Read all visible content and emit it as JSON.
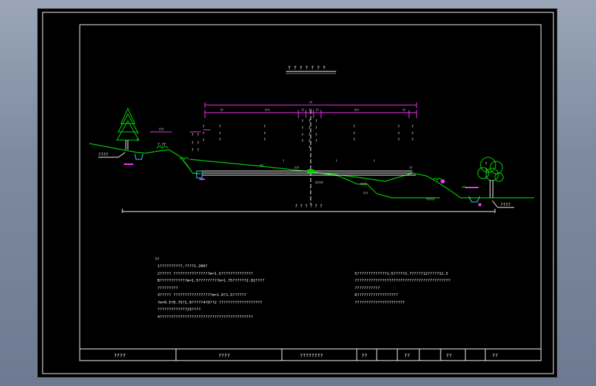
{
  "drawing": {
    "title": "? ? ? ? ? ? ?",
    "bottom_centerline_label": "? ? ? ? ? ?",
    "left_label": "????",
    "right_label": "????",
    "left_dim": "?.??",
    "center_mark": "????"
  },
  "notes": {
    "heading": "??",
    "left": [
      "1??????????,????1.200?",
      "2????? ????????????????m=1.5??????????????",
      "   B????????????m=1.5?????????m=1.75??????2.02????",
      "   ?????????",
      "3????? ?????????????????m=1.0?1.5??????",
      "   ?m=0.5?0.75?1.0?????4?0??2 ???????????????????",
      "   ?????????????23????",
      "4?????????????????????????????????????????"
    ],
    "right": [
      "5?????????????1:5?????2.7?????12?????12.5",
      "   ??????????????????????????????????????????",
      "   ???????????",
      "6??????????????????",
      "??????????????????????"
    ]
  },
  "title_block": {
    "cells": [
      "????",
      "????",
      "????????",
      "??",
      "??",
      "??",
      "??"
    ]
  }
}
